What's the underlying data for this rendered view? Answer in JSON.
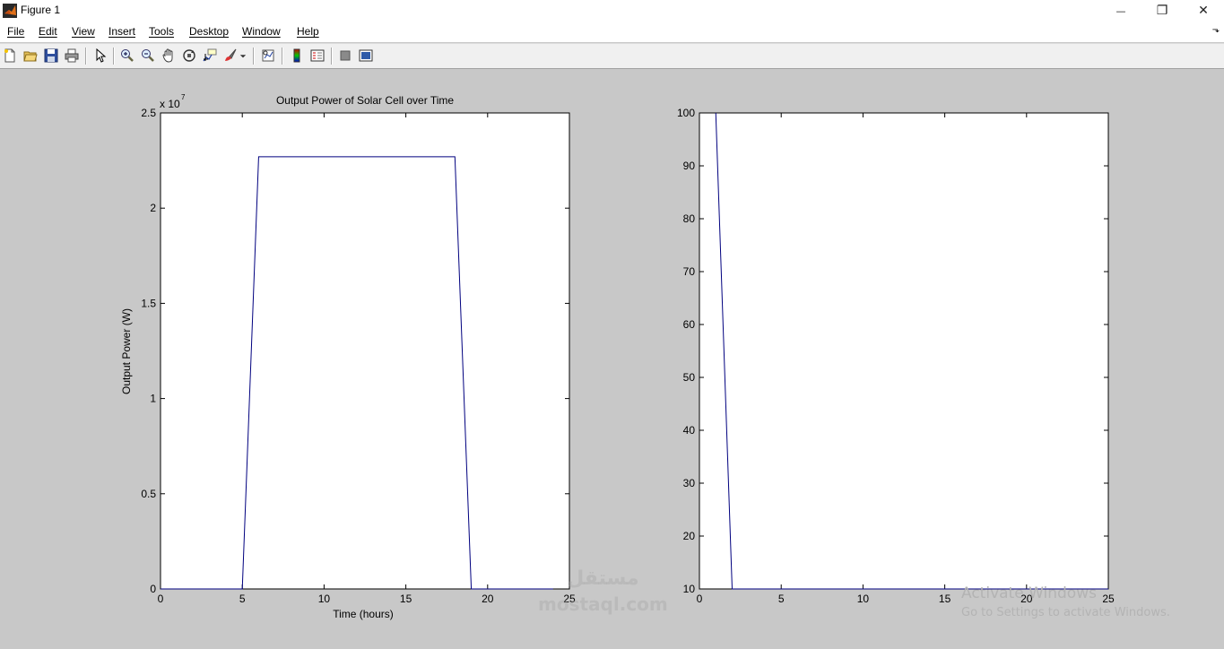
{
  "window": {
    "title": "Figure 1",
    "controls": {
      "minimize": "—",
      "maximize": "❐",
      "close": "✕"
    }
  },
  "menu": {
    "items": [
      "File",
      "Edit",
      "View",
      "Insert",
      "Tools",
      "Desktop",
      "Window",
      "Help"
    ],
    "overflow_arrow": "⬎"
  },
  "toolbar": {
    "icons": [
      "new-figure-icon",
      "open-file-icon",
      "save-icon",
      "print-icon",
      "pointer-icon",
      "zoom-in-icon",
      "zoom-out-icon",
      "pan-icon",
      "rotate-3d-icon",
      "data-cursor-icon",
      "brush-icon",
      "link-plot-icon",
      "colorbar-icon",
      "legend-icon",
      "hide-plot-tools-icon",
      "show-plot-tools-icon"
    ]
  },
  "watermark": {
    "line1": "Activate Windows",
    "line2": "Go to Settings to activate Windows.",
    "site_arabic": "مستقل",
    "site_latin": "mostaql.com"
  },
  "chart_data": [
    {
      "type": "line",
      "title": "Output Power of Solar Cell over Time",
      "xlabel": "Time (hours)",
      "ylabel": "Output Power (W)",
      "exponent_label": "x 10",
      "exponent_power": "7",
      "xlim": [
        0,
        25
      ],
      "ylim": [
        0,
        2.5
      ],
      "xticks": [
        "0",
        "5",
        "10",
        "15",
        "20",
        "25"
      ],
      "yticks": [
        "0",
        "0.5",
        "1",
        "1.5",
        "2",
        "2.5"
      ],
      "line_color": "#00007f",
      "series": [
        {
          "x": [
            0,
            1,
            2,
            3,
            4,
            5,
            6,
            7,
            8,
            9,
            10,
            11,
            12,
            13,
            14,
            15,
            16,
            17,
            18,
            19,
            20,
            21,
            22,
            23,
            24
          ],
          "y": [
            0,
            0,
            0,
            0,
            0,
            0,
            2.27,
            2.27,
            2.27,
            2.27,
            2.27,
            2.27,
            2.27,
            2.27,
            2.27,
            2.27,
            2.27,
            2.27,
            2.27,
            0,
            0,
            0,
            0,
            0,
            0
          ]
        }
      ]
    },
    {
      "type": "line",
      "title": "",
      "xlabel": "",
      "ylabel": "",
      "xlim": [
        0,
        25
      ],
      "ylim": [
        10,
        100
      ],
      "xticks": [
        "0",
        "5",
        "10",
        "15",
        "20",
        "25"
      ],
      "yticks": [
        "10",
        "20",
        "30",
        "40",
        "50",
        "60",
        "70",
        "80",
        "90",
        "100"
      ],
      "line_color": "#00007f",
      "series": [
        {
          "x": [
            1,
            2,
            3,
            4,
            5,
            6,
            7,
            8,
            9,
            10,
            11,
            12,
            13,
            14,
            15,
            16,
            17,
            18,
            19,
            20,
            21,
            22,
            23,
            24,
            25
          ],
          "y": [
            100,
            10,
            10,
            10,
            10,
            10,
            10,
            10,
            10,
            10,
            10,
            10,
            10,
            10,
            10,
            10,
            10,
            10,
            10,
            10,
            10,
            10,
            10,
            10,
            10
          ]
        }
      ]
    }
  ]
}
